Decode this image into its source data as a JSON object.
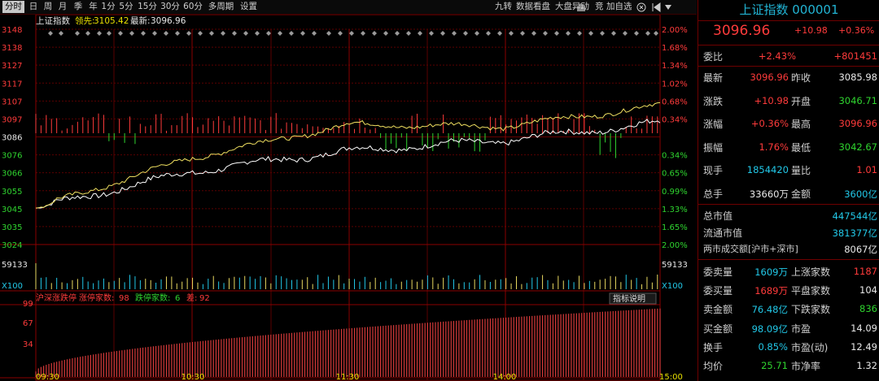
{
  "toolbar": {
    "tabs": [
      "分时",
      "日",
      "周",
      "月",
      "季",
      "年",
      "1分",
      "5分",
      "15分",
      "30分",
      "60分",
      "多周期",
      "设置"
    ],
    "active_tab": "分时",
    "right_items": [
      "九转",
      "数据看盘",
      "大盘异动",
      "竞",
      "加自选"
    ]
  },
  "chart": {
    "index_name": "上证指数",
    "lead_label": "领先:",
    "lead_value": "3105.42",
    "latest_label": "最新:",
    "latest_value": "3096.96",
    "price_ticks": [
      "3148",
      "3138",
      "3127",
      "3117",
      "3107",
      "3097",
      "3086",
      "3076",
      "3066",
      "3055",
      "3045",
      "3035",
      "3024"
    ],
    "pct_ticks": [
      "2.00%",
      "1.68%",
      "1.34%",
      "1.02%",
      "0.68%",
      "0.34%",
      "",
      "0.34%",
      "0.65%",
      "0.99%",
      "1.33%",
      "1.65%",
      "2.00%"
    ],
    "volume_tick": "59133",
    "volume_unit": "X100",
    "breadth_legend": "沪深涨跌停",
    "limit_up_label": "涨停家数:",
    "limit_up_value": "98",
    "limit_down_label": "跌停家数:",
    "limit_down_value": "6",
    "diff_label": "差:",
    "diff_value": "92",
    "indicator_button": "指标说明",
    "breadth_ticks": [
      "99",
      "67",
      "34"
    ],
    "time_ticks": [
      "09:30",
      "10:30",
      "11:30",
      "14:00",
      "15:00"
    ],
    "colors": {
      "up": "#ff3b3b",
      "down": "#2fd42f",
      "white_line": "#ffffff",
      "yellow_line": "#f0e060",
      "grid": "#6e0000"
    }
  },
  "chart_data": {
    "type": "line",
    "x": [
      "09:30",
      "10:30",
      "11:30/13:00",
      "14:00",
      "15:00"
    ],
    "series": [
      {
        "name": "最新",
        "values": [
          3045.0,
          3066.0,
          3078.0,
          3084.0,
          3094.0
        ]
      },
      {
        "name": "领先",
        "values": [
          3045.0,
          3074.0,
          3093.0,
          3092.0,
          3104.0
        ]
      }
    ],
    "ylim": [
      3024,
      3148
    ],
    "ylabel_right": "%",
    "breadth": {
      "limit_up": 98,
      "limit_down": 6,
      "diff": 92
    },
    "volume_max": 59133
  },
  "panel": {
    "title": "上证指数 000001",
    "price": "3096.96",
    "change": "+10.98",
    "change_pct": "+0.36%",
    "weibi_label": "委比",
    "weibi_pct": "+2.43%",
    "weibi_value": "+801451",
    "rows_a": [
      {
        "l1": "最新",
        "v1": "3096.96",
        "c1": "red",
        "l2": "昨收",
        "v2": "3085.98",
        "c2": "white"
      },
      {
        "l1": "涨跌",
        "v1": "+10.98",
        "c1": "red",
        "l2": "开盘",
        "v2": "3046.71",
        "c2": "green"
      },
      {
        "l1": "涨幅",
        "v1": "+0.36%",
        "c1": "red",
        "l2": "最高",
        "v2": "3096.96",
        "c2": "red"
      },
      {
        "l1": "振幅",
        "v1": "1.76%",
        "c1": "red",
        "l2": "最低",
        "v2": "3042.67",
        "c2": "green"
      },
      {
        "l1": "现手",
        "v1": "1854420",
        "c1": "cyan",
        "l2": "量比",
        "v2": "1.01",
        "c2": "red"
      },
      {
        "l1": "总手",
        "v1": "33660万",
        "c1": "white",
        "l2": "金额",
        "v2": "3600亿",
        "c2": "cyan"
      }
    ],
    "rows_b": [
      {
        "l": "总市值",
        "v": "447544亿",
        "c": "cyan"
      },
      {
        "l": "流通市值",
        "v": "381377亿",
        "c": "cyan"
      },
      {
        "l": "两市成交额[沪市+深市]",
        "v": "8067亿",
        "c": "white"
      }
    ],
    "rows_c": [
      {
        "l1": "委卖量",
        "v1": "1609万",
        "c1": "cyan",
        "l2": "上涨家数",
        "v2": "1187",
        "c2": "red"
      },
      {
        "l1": "委买量",
        "v1": "1689万",
        "c1": "red",
        "l2": "平盘家数",
        "v2": "104",
        "c2": "white"
      },
      {
        "l1": "卖金额",
        "v1": "76.48亿",
        "c1": "cyan",
        "l2": "下跌家数",
        "v2": "836",
        "c2": "green"
      },
      {
        "l1": "买金额",
        "v1": "98.09亿",
        "c1": "cyan",
        "l2": "市盈",
        "v2": "14.09",
        "c2": "white"
      },
      {
        "l1": "换手",
        "v1": "0.85%",
        "c1": "cyan",
        "l2": "市盈(动)",
        "v2": "12.49",
        "c2": "white"
      },
      {
        "l1": "均价",
        "v1": "25.71",
        "c1": "green",
        "l2": "市净率",
        "v2": "1.32",
        "c2": "white"
      }
    ]
  }
}
